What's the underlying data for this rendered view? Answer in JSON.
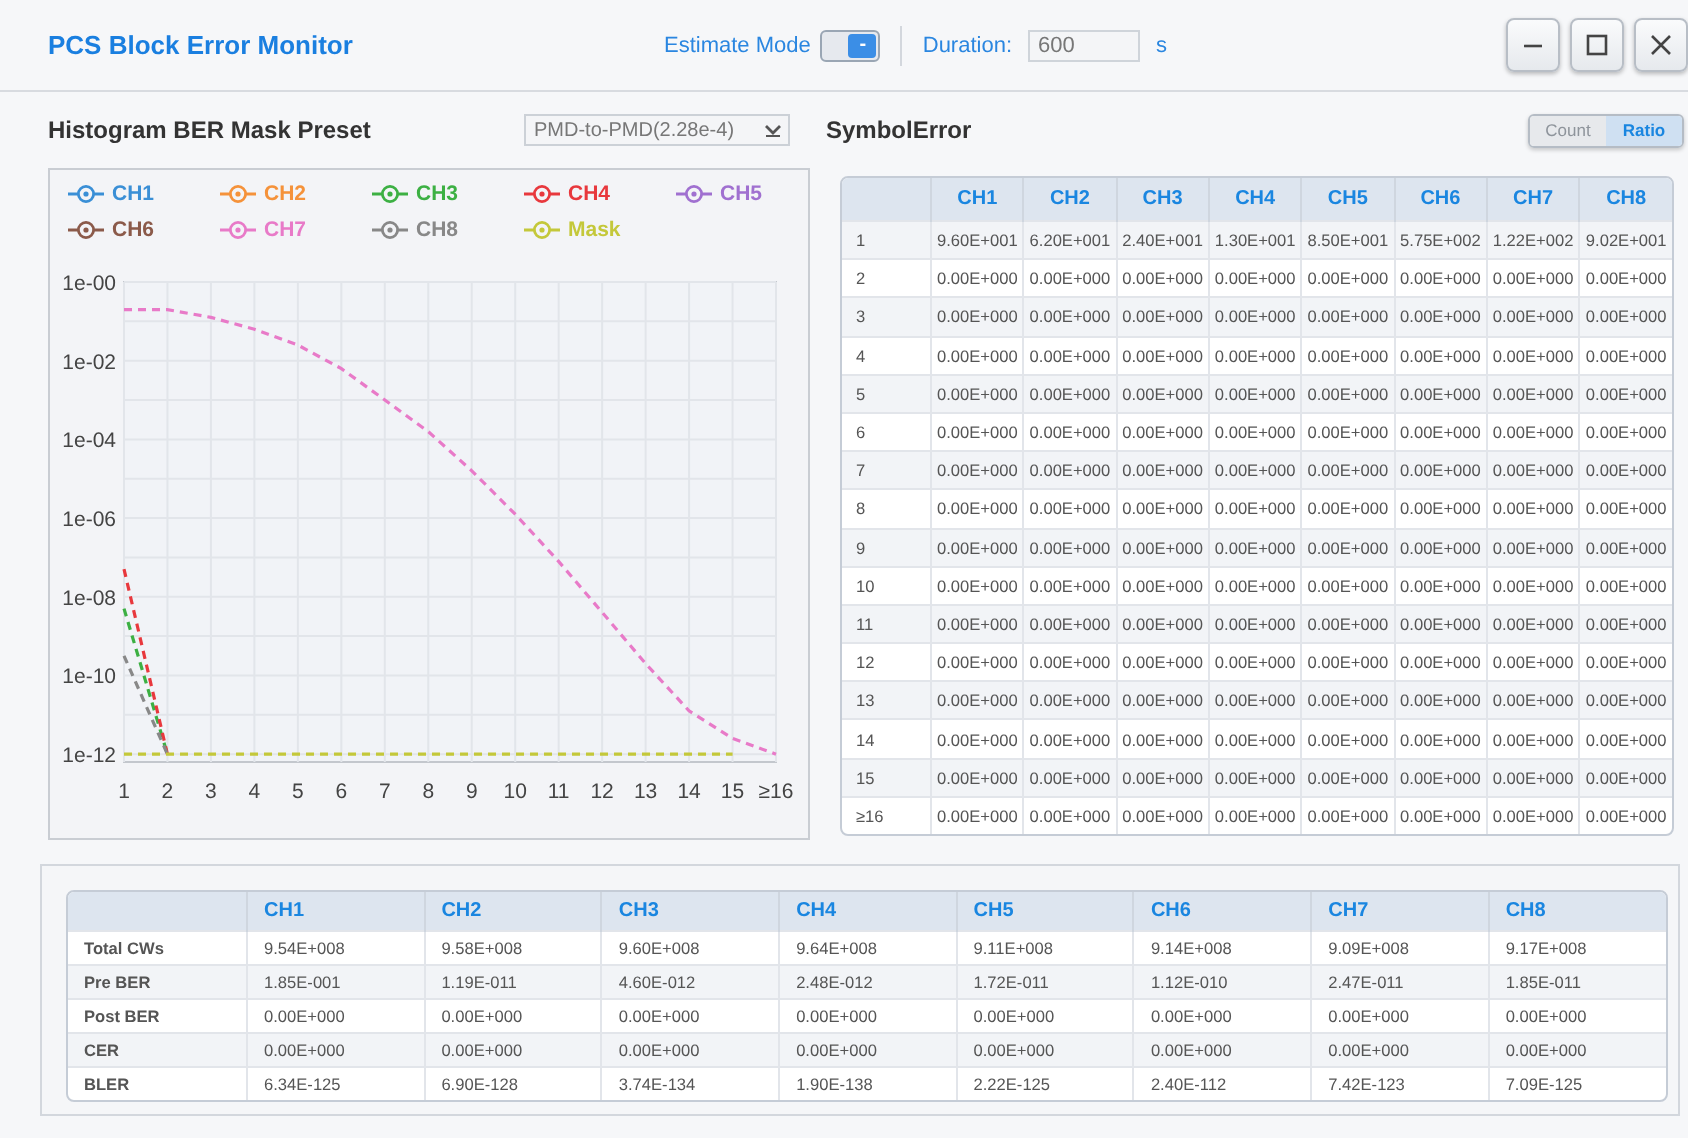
{
  "window": {
    "title": "PCS Block Error Monitor",
    "controls": [
      {
        "kind": "minimize"
      },
      {
        "kind": "maximize"
      },
      {
        "kind": "close"
      }
    ]
  },
  "header": {
    "estimate_mode": {
      "label": "Estimate Mode",
      "on": true,
      "knob": "-"
    },
    "duration": {
      "label": "Duration:",
      "value": "600",
      "unit": "s"
    }
  },
  "histogram": {
    "title": "Histogram BER Mask Preset",
    "preset": {
      "value": "PMD-to-PMD(2.28e-4)"
    },
    "legend": [
      {
        "label": "CH1",
        "color": "#3a8fd6"
      },
      {
        "label": "CH2",
        "color": "#f5923a"
      },
      {
        "label": "CH3",
        "color": "#3cb043"
      },
      {
        "label": "CH4",
        "color": "#e8383d"
      },
      {
        "label": "CH5",
        "color": "#a070d0"
      },
      {
        "label": "CH6",
        "color": "#8b5a4a"
      },
      {
        "label": "CH7",
        "color": "#e87ac8"
      },
      {
        "label": "CH8",
        "color": "#888888"
      },
      {
        "label": "Mask",
        "color": "#c4c83a"
      }
    ],
    "y_axis_labels": [
      "1e-00",
      "1e-02",
      "1e-04",
      "1e-06",
      "1e-08",
      "1e-10",
      "1e-12"
    ],
    "x_axis_labels": [
      "1",
      "2",
      "3",
      "4",
      "5",
      "6",
      "7",
      "8",
      "9",
      "10",
      "11",
      "12",
      "13",
      "14",
      "15",
      "≥16"
    ]
  },
  "symbol_error": {
    "title": "SymbolError",
    "view_toggle": [
      {
        "label": "Count",
        "selected": false
      },
      {
        "label": "Ratio",
        "selected": true
      }
    ],
    "table": {
      "columns": [
        "CH1",
        "CH2",
        "CH3",
        "CH4",
        "CH5",
        "CH6",
        "CH7",
        "CH8"
      ],
      "rows": [
        {
          "label": "1",
          "cells": [
            "9.60E+001",
            "6.20E+001",
            "2.40E+001",
            "1.30E+001",
            "8.50E+001",
            "5.75E+002",
            "1.22E+002",
            "9.02E+001"
          ]
        },
        {
          "label": "2",
          "cells": [
            "0.00E+000",
            "0.00E+000",
            "0.00E+000",
            "0.00E+000",
            "0.00E+000",
            "0.00E+000",
            "0.00E+000",
            "0.00E+000"
          ]
        },
        {
          "label": "3",
          "cells": [
            "0.00E+000",
            "0.00E+000",
            "0.00E+000",
            "0.00E+000",
            "0.00E+000",
            "0.00E+000",
            "0.00E+000",
            "0.00E+000"
          ]
        },
        {
          "label": "4",
          "cells": [
            "0.00E+000",
            "0.00E+000",
            "0.00E+000",
            "0.00E+000",
            "0.00E+000",
            "0.00E+000",
            "0.00E+000",
            "0.00E+000"
          ]
        },
        {
          "label": "5",
          "cells": [
            "0.00E+000",
            "0.00E+000",
            "0.00E+000",
            "0.00E+000",
            "0.00E+000",
            "0.00E+000",
            "0.00E+000",
            "0.00E+000"
          ]
        },
        {
          "label": "6",
          "cells": [
            "0.00E+000",
            "0.00E+000",
            "0.00E+000",
            "0.00E+000",
            "0.00E+000",
            "0.00E+000",
            "0.00E+000",
            "0.00E+000"
          ]
        },
        {
          "label": "7",
          "cells": [
            "0.00E+000",
            "0.00E+000",
            "0.00E+000",
            "0.00E+000",
            "0.00E+000",
            "0.00E+000",
            "0.00E+000",
            "0.00E+000"
          ]
        },
        {
          "label": "8",
          "cells": [
            "0.00E+000",
            "0.00E+000",
            "0.00E+000",
            "0.00E+000",
            "0.00E+000",
            "0.00E+000",
            "0.00E+000",
            "0.00E+000"
          ]
        },
        {
          "label": "9",
          "cells": [
            "0.00E+000",
            "0.00E+000",
            "0.00E+000",
            "0.00E+000",
            "0.00E+000",
            "0.00E+000",
            "0.00E+000",
            "0.00E+000"
          ]
        },
        {
          "label": "10",
          "cells": [
            "0.00E+000",
            "0.00E+000",
            "0.00E+000",
            "0.00E+000",
            "0.00E+000",
            "0.00E+000",
            "0.00E+000",
            "0.00E+000"
          ]
        },
        {
          "label": "11",
          "cells": [
            "0.00E+000",
            "0.00E+000",
            "0.00E+000",
            "0.00E+000",
            "0.00E+000",
            "0.00E+000",
            "0.00E+000",
            "0.00E+000"
          ]
        },
        {
          "label": "12",
          "cells": [
            "0.00E+000",
            "0.00E+000",
            "0.00E+000",
            "0.00E+000",
            "0.00E+000",
            "0.00E+000",
            "0.00E+000",
            "0.00E+000"
          ]
        },
        {
          "label": "13",
          "cells": [
            "0.00E+000",
            "0.00E+000",
            "0.00E+000",
            "0.00E+000",
            "0.00E+000",
            "0.00E+000",
            "0.00E+000",
            "0.00E+000"
          ]
        },
        {
          "label": "14",
          "cells": [
            "0.00E+000",
            "0.00E+000",
            "0.00E+000",
            "0.00E+000",
            "0.00E+000",
            "0.00E+000",
            "0.00E+000",
            "0.00E+000"
          ]
        },
        {
          "label": "15",
          "cells": [
            "0.00E+000",
            "0.00E+000",
            "0.00E+000",
            "0.00E+000",
            "0.00E+000",
            "0.00E+000",
            "0.00E+000",
            "0.00E+000"
          ]
        },
        {
          "label": "≥16",
          "cells": [
            "0.00E+000",
            "0.00E+000",
            "0.00E+000",
            "0.00E+000",
            "0.00E+000",
            "0.00E+000",
            "0.00E+000",
            "0.00E+000"
          ]
        }
      ]
    }
  },
  "summary": {
    "columns": [
      "CH1",
      "CH2",
      "CH3",
      "CH4",
      "CH5",
      "CH6",
      "CH7",
      "CH8"
    ],
    "rows": [
      {
        "label": "Total CWs",
        "cells": [
          "9.54E+008",
          "9.58E+008",
          "9.60E+008",
          "9.64E+008",
          "9.11E+008",
          "9.14E+008",
          "9.09E+008",
          "9.17E+008"
        ]
      },
      {
        "label": "Pre BER",
        "cells": [
          "1.85E-001",
          "1.19E-011",
          "4.60E-012",
          "2.48E-012",
          "1.72E-011",
          "1.12E-010",
          "2.47E-011",
          "1.85E-011"
        ]
      },
      {
        "label": "Post BER",
        "cells": [
          "0.00E+000",
          "0.00E+000",
          "0.00E+000",
          "0.00E+000",
          "0.00E+000",
          "0.00E+000",
          "0.00E+000",
          "0.00E+000"
        ]
      },
      {
        "label": "CER",
        "cells": [
          "0.00E+000",
          "0.00E+000",
          "0.00E+000",
          "0.00E+000",
          "0.00E+000",
          "0.00E+000",
          "0.00E+000",
          "0.00E+000"
        ]
      },
      {
        "label": "BLER",
        "cells": [
          "6.34E-125",
          "6.90E-128",
          "3.74E-134",
          "1.90E-138",
          "2.22E-125",
          "2.40E-112",
          "7.42E-123",
          "7.09E-125"
        ]
      }
    ]
  }
}
